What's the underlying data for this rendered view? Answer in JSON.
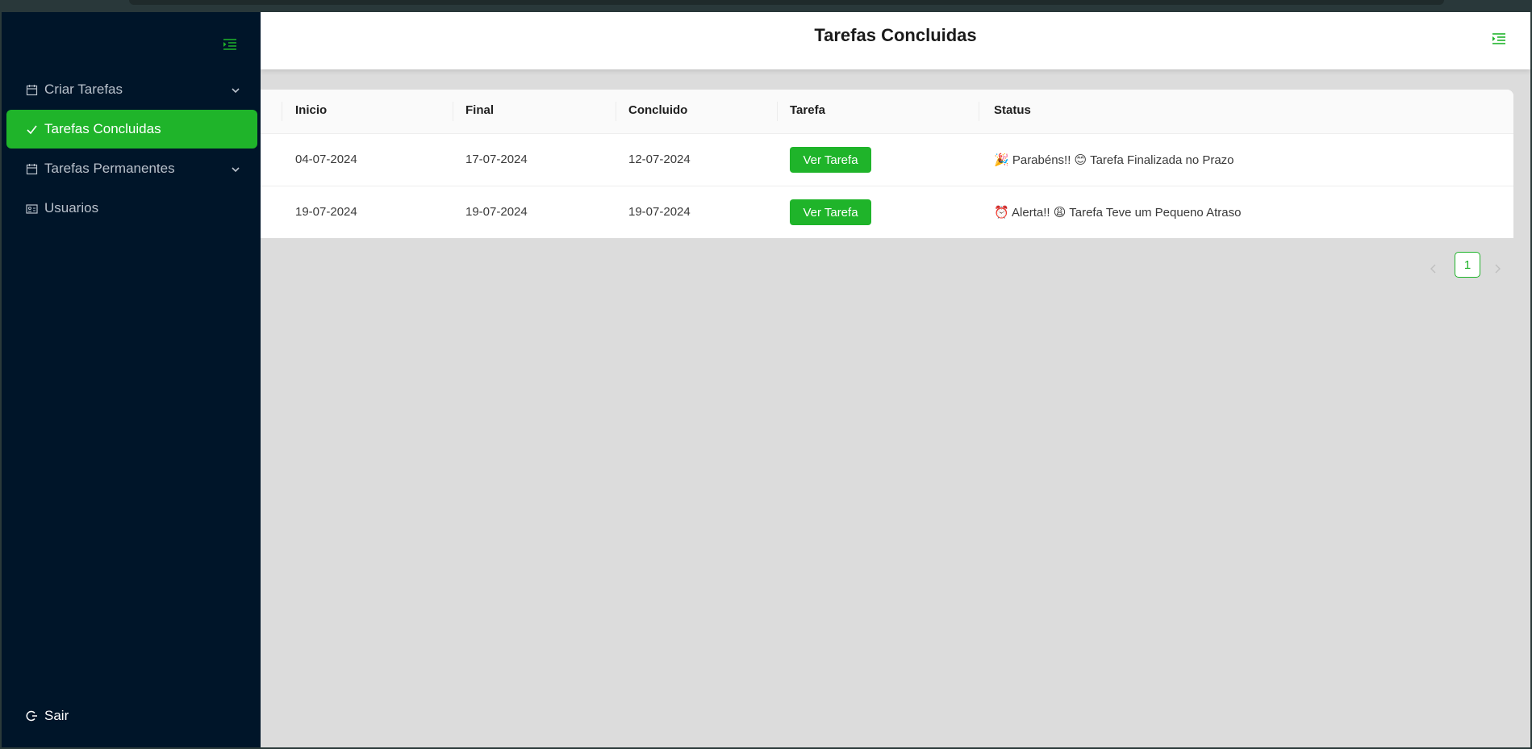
{
  "header": {
    "title": "Tarefas Concluidas",
    "menu_icon": "menu-fold-icon"
  },
  "sidebar": {
    "items": [
      {
        "label": "Criar Tarefas",
        "icon": "calendar-icon",
        "has_submenu": true,
        "active": false
      },
      {
        "label": "Tarefas Concluidas",
        "icon": "check-icon",
        "has_submenu": false,
        "active": true
      },
      {
        "label": "Tarefas Permanentes",
        "icon": "calendar-icon",
        "has_submenu": true,
        "active": false
      },
      {
        "label": "Usuarios",
        "icon": "id-card-icon",
        "has_submenu": false,
        "active": false
      }
    ],
    "logout_label": "Sair"
  },
  "table": {
    "columns": [
      "Inicio",
      "Final",
      "Concluido",
      "Tarefa",
      "Status"
    ],
    "rows": [
      {
        "inicio": "04-07-2024",
        "final": "17-07-2024",
        "concluido": "12-07-2024",
        "button": "Ver Tarefa",
        "status": "🎉 Parabéns!! 😊 Tarefa Finalizada no Prazo"
      },
      {
        "inicio": "19-07-2024",
        "final": "19-07-2024",
        "concluido": "19-07-2024",
        "button": "Ver Tarefa",
        "status": "⏰ Alerta!! 😩 Tarefa Teve um Pequeno Atraso"
      }
    ]
  },
  "pagination": {
    "current": "1"
  },
  "colors": {
    "accent": "#1fb42a",
    "sidebar": "#001529",
    "background": "#dcdcdc"
  }
}
